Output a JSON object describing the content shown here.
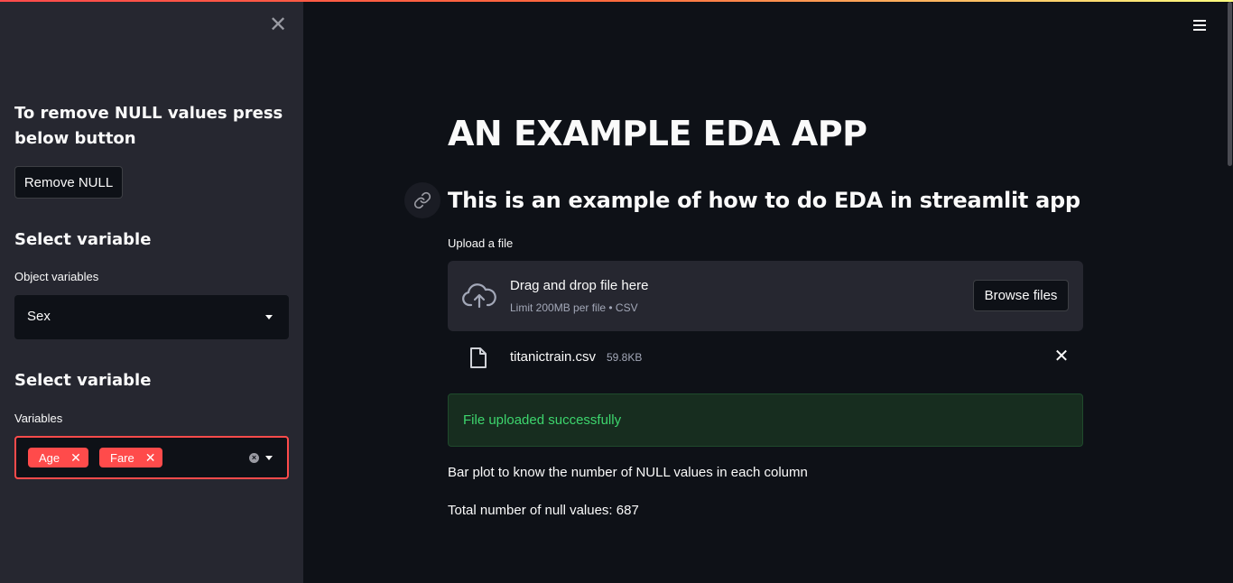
{
  "sidebar": {
    "close_icon": "close-icon",
    "null_heading": "To remove NULL values press below button",
    "remove_null_button": "Remove NULL",
    "select_heading_1": "Select variable",
    "object_label": "Object variables",
    "object_selected": "Sex",
    "select_heading_2": "Select variable",
    "variables_label": "Variables",
    "variables_selected": [
      "Age",
      "Fare"
    ],
    "accent_color": "#ff4b4b"
  },
  "main": {
    "menu_icon": "hamburger-menu-icon",
    "title": "AN EXAMPLE EDA APP",
    "subtitle": "This is an example of how to do EDA in streamlit app",
    "upload": {
      "label": "Upload a file",
      "drop_text": "Drag and drop file here",
      "limit_text": "Limit 200MB per file • CSV",
      "browse_button": "Browse files"
    },
    "file": {
      "name": "titanictrain.csv",
      "size": "59.8KB"
    },
    "success_message": "File uploaded successfully",
    "success_color": "#3dd56d",
    "bar_plot_text": "Bar plot to know the number of NULL values in each column",
    "null_total_text": "Total number of null values: 687"
  }
}
